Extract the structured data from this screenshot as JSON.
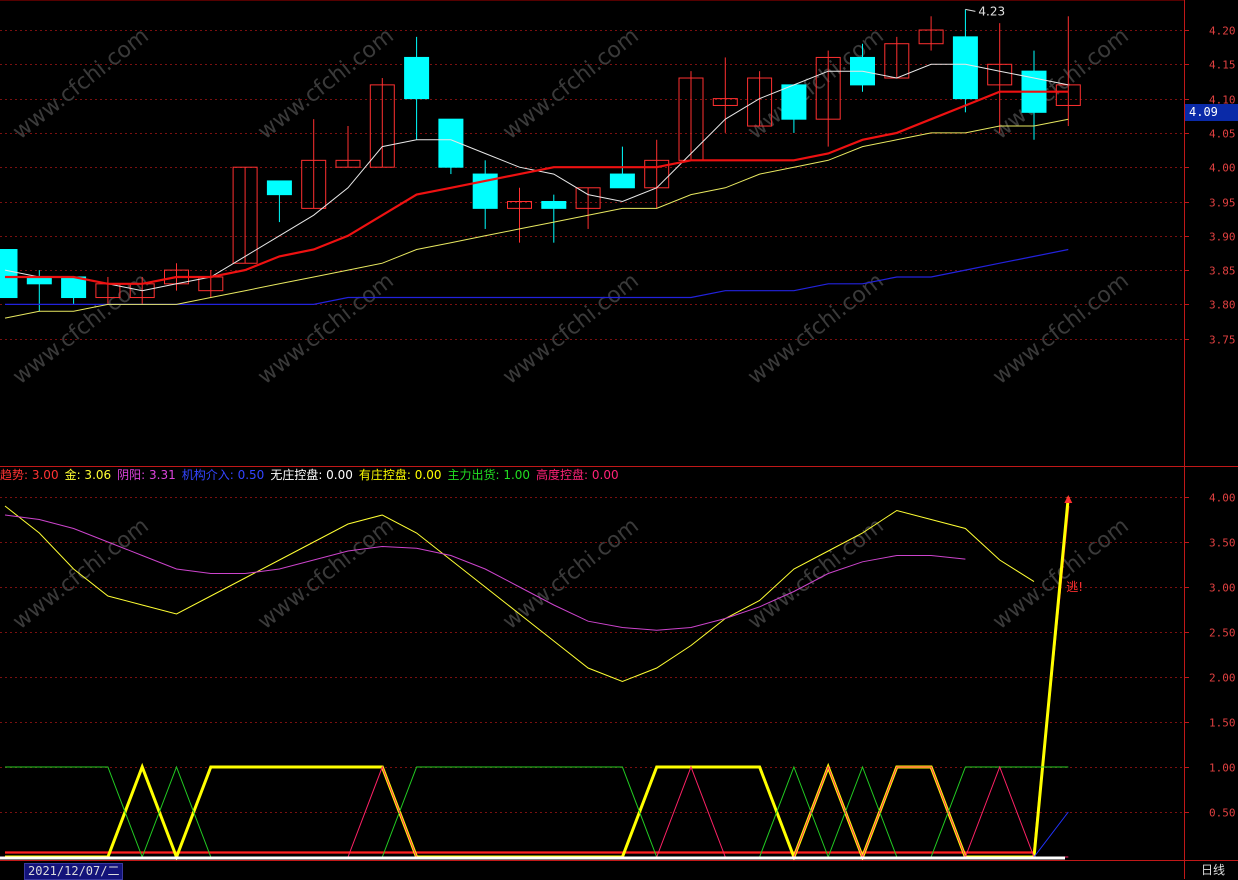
{
  "chart_data": [
    {
      "type": "candlestick",
      "title": "",
      "y_ticks": [
        "4.20",
        "4.15",
        "4.10",
        "4.05",
        "4.00",
        "3.95",
        "3.90",
        "3.85",
        "3.80",
        "3.75"
      ],
      "y_range": [
        3.7,
        4.24
      ],
      "current_price": "4.09",
      "high_annotation": "4.23",
      "candles": [
        {
          "o": 3.88,
          "h": 3.88,
          "l": 3.81,
          "c": 3.81
        },
        {
          "o": 3.84,
          "h": 3.85,
          "l": 3.79,
          "c": 3.83
        },
        {
          "o": 3.84,
          "h": 3.84,
          "l": 3.8,
          "c": 3.81
        },
        {
          "o": 3.81,
          "h": 3.84,
          "l": 3.8,
          "c": 3.83
        },
        {
          "o": 3.81,
          "h": 3.84,
          "l": 3.8,
          "c": 3.83
        },
        {
          "o": 3.83,
          "h": 3.86,
          "l": 3.82,
          "c": 3.85
        },
        {
          "o": 3.82,
          "h": 3.85,
          "l": 3.81,
          "c": 3.84
        },
        {
          "o": 3.86,
          "h": 4.0,
          "l": 3.86,
          "c": 4.0
        },
        {
          "o": 3.98,
          "h": 3.98,
          "l": 3.92,
          "c": 3.96
        },
        {
          "o": 3.94,
          "h": 4.07,
          "l": 3.94,
          "c": 4.01
        },
        {
          "o": 4.0,
          "h": 4.06,
          "l": 4.0,
          "c": 4.01
        },
        {
          "o": 4.0,
          "h": 4.13,
          "l": 4.0,
          "c": 4.12
        },
        {
          "o": 4.16,
          "h": 4.19,
          "l": 4.04,
          "c": 4.1
        },
        {
          "o": 4.07,
          "h": 4.07,
          "l": 3.99,
          "c": 4.0
        },
        {
          "o": 3.99,
          "h": 4.01,
          "l": 3.91,
          "c": 3.94
        },
        {
          "o": 3.94,
          "h": 3.97,
          "l": 3.89,
          "c": 3.95
        },
        {
          "o": 3.95,
          "h": 3.96,
          "l": 3.89,
          "c": 3.94
        },
        {
          "o": 3.94,
          "h": 3.97,
          "l": 3.91,
          "c": 3.97
        },
        {
          "o": 3.99,
          "h": 4.03,
          "l": 3.97,
          "c": 3.97
        },
        {
          "o": 3.97,
          "h": 4.04,
          "l": 3.94,
          "c": 4.01
        },
        {
          "o": 4.01,
          "h": 4.14,
          "l": 4.01,
          "c": 4.13
        },
        {
          "o": 4.09,
          "h": 4.16,
          "l": 4.05,
          "c": 4.1
        },
        {
          "o": 4.06,
          "h": 4.14,
          "l": 4.06,
          "c": 4.13
        },
        {
          "o": 4.12,
          "h": 4.12,
          "l": 4.05,
          "c": 4.07
        },
        {
          "o": 4.07,
          "h": 4.17,
          "l": 4.03,
          "c": 4.16
        },
        {
          "o": 4.16,
          "h": 4.18,
          "l": 4.11,
          "c": 4.12
        },
        {
          "o": 4.13,
          "h": 4.19,
          "l": 4.13,
          "c": 4.18
        },
        {
          "o": 4.18,
          "h": 4.22,
          "l": 4.17,
          "c": 4.2
        },
        {
          "o": 4.19,
          "h": 4.23,
          "l": 4.08,
          "c": 4.1
        },
        {
          "o": 4.12,
          "h": 4.21,
          "l": 4.05,
          "c": 4.15
        },
        {
          "o": 4.14,
          "h": 4.17,
          "l": 4.04,
          "c": 4.08
        },
        {
          "o": 4.09,
          "h": 4.22,
          "l": 4.06,
          "c": 4.12
        }
      ],
      "ma_white": [
        3.85,
        3.84,
        3.84,
        3.83,
        3.82,
        3.83,
        3.84,
        3.87,
        3.9,
        3.93,
        3.97,
        4.03,
        4.04,
        4.04,
        4.02,
        4.0,
        3.99,
        3.96,
        3.95,
        3.97,
        4.02,
        4.07,
        4.1,
        4.12,
        4.14,
        4.14,
        4.13,
        4.15,
        4.15,
        4.14,
        4.13,
        4.12
      ],
      "ma_red": [
        3.84,
        3.84,
        3.84,
        3.83,
        3.83,
        3.84,
        3.84,
        3.85,
        3.87,
        3.88,
        3.9,
        3.93,
        3.96,
        3.97,
        3.98,
        3.99,
        4.0,
        4.0,
        4.0,
        4.0,
        4.01,
        4.01,
        4.01,
        4.01,
        4.02,
        4.04,
        4.05,
        4.07,
        4.09,
        4.11,
        4.11,
        4.11
      ],
      "ma_yellow": [
        3.78,
        3.79,
        3.79,
        3.8,
        3.8,
        3.8,
        3.81,
        3.82,
        3.83,
        3.84,
        3.85,
        3.86,
        3.88,
        3.89,
        3.9,
        3.91,
        3.92,
        3.93,
        3.94,
        3.94,
        3.96,
        3.97,
        3.99,
        4.0,
        4.01,
        4.03,
        4.04,
        4.05,
        4.05,
        4.06,
        4.06,
        4.07
      ],
      "ma_blue": [
        3.8,
        3.8,
        3.8,
        3.8,
        3.8,
        3.8,
        3.8,
        3.8,
        3.8,
        3.8,
        3.81,
        3.81,
        3.81,
        3.81,
        3.81,
        3.81,
        3.81,
        3.81,
        3.81,
        3.81,
        3.81,
        3.82,
        3.82,
        3.82,
        3.83,
        3.83,
        3.84,
        3.84,
        3.85,
        3.86,
        3.87,
        3.88
      ]
    },
    {
      "type": "line",
      "y_ticks": [
        "4.00",
        "3.50",
        "3.00",
        "2.50",
        "2.00",
        "1.50",
        "1.00",
        "0.50"
      ],
      "y_range": [
        0,
        4.3
      ],
      "signal_label": "逃!",
      "series": [
        {
          "name": "金",
          "color": "#ffff33",
          "values": [
            3.9,
            3.6,
            3.2,
            2.9,
            2.8,
            2.7,
            2.9,
            3.1,
            3.3,
            3.5,
            3.7,
            3.8,
            3.6,
            3.3,
            3.0,
            2.7,
            2.4,
            2.1,
            1.95,
            2.1,
            2.35,
            2.65,
            2.85,
            3.2,
            3.4,
            3.6,
            3.85,
            3.75,
            3.65,
            3.3,
            3.06
          ]
        },
        {
          "name": "阴阳",
          "color": "#cc44cc",
          "values": [
            3.8,
            3.75,
            3.65,
            3.5,
            3.35,
            3.2,
            3.15,
            3.15,
            3.2,
            3.3,
            3.4,
            3.45,
            3.43,
            3.35,
            3.2,
            3.0,
            2.8,
            2.62,
            2.55,
            2.52,
            2.55,
            2.65,
            2.78,
            2.95,
            3.15,
            3.28,
            3.35,
            3.35,
            3.31
          ]
        },
        {
          "name": "趋势",
          "color": "#ff2020",
          "values": [
            0.05,
            0.05,
            0.05,
            0.05,
            0.05,
            0.05,
            0.05,
            0.05,
            0.05,
            0.05,
            0.05,
            0.05,
            0.05,
            0.05,
            0.05,
            0.05,
            0.05,
            0.05,
            0.05,
            0.05,
            0.05,
            0.05,
            0.05,
            0.05,
            0.05,
            0.05,
            0.05,
            0.05,
            0.05,
            0.05,
            0.05,
            3.9
          ]
        },
        {
          "name": "金信号",
          "color": "#ffff00",
          "values": [
            0,
            0,
            0,
            0,
            1,
            0,
            1,
            1,
            1,
            1,
            1,
            1,
            0,
            0,
            0,
            0,
            0,
            0,
            0,
            1,
            1,
            1,
            1,
            0,
            1,
            0,
            1,
            1,
            0,
            0,
            0,
            4.0
          ]
        },
        {
          "name": "主力出货",
          "color": "#22cc22",
          "values": [
            1,
            1,
            1,
            1,
            0,
            1,
            0,
            0,
            0,
            0,
            0,
            0,
            1,
            1,
            1,
            1,
            1,
            1,
            1,
            0,
            0,
            0,
            0,
            1,
            0,
            1,
            0,
            0,
            1,
            1,
            1,
            1
          ]
        },
        {
          "name": "高度控盘",
          "color": "#ff2266",
          "values": [
            0,
            0,
            0,
            0,
            0,
            0,
            0,
            0,
            0,
            0,
            0,
            1,
            0,
            0,
            0,
            0,
            0,
            0,
            0,
            0,
            1,
            0,
            0,
            0,
            1,
            0,
            1,
            1,
            0,
            1,
            0,
            0
          ]
        },
        {
          "name": "机构介入",
          "color": "#2233ff",
          "values": [
            0,
            0,
            0,
            0,
            0,
            0,
            0,
            0,
            0,
            0,
            0,
            0,
            0,
            0,
            0,
            0,
            0,
            0,
            0,
            0,
            0,
            0,
            0,
            0,
            0,
            0,
            0,
            0,
            0,
            0,
            0,
            0.5
          ]
        }
      ]
    }
  ],
  "legend": [
    {
      "label": "趋势: 3.00",
      "color": "#ff3333"
    },
    {
      "label": "金: 3.06",
      "color": "#ffff33"
    },
    {
      "label": "阴阳: 3.31",
      "color": "#dd44dd"
    },
    {
      "label": "机构介入: 0.50",
      "color": "#3344ff"
    },
    {
      "label": "无庄控盘: 0.00",
      "color": "#ffffff"
    },
    {
      "label": "有庄控盘: 0.00",
      "color": "#ffff00"
    },
    {
      "label": "主力出货: 1.00",
      "color": "#22dd22"
    },
    {
      "label": "高度控盘: 0.00",
      "color": "#ff2277"
    }
  ],
  "footer": {
    "date": "2021/12/07/二",
    "period": "日线"
  },
  "watermark": "www.cfchi.com",
  "colors": {
    "up": "#ff3030",
    "down": "#00ffff",
    "grid": "#7a1010",
    "axis": "#c01818",
    "tick": "#e04040"
  }
}
